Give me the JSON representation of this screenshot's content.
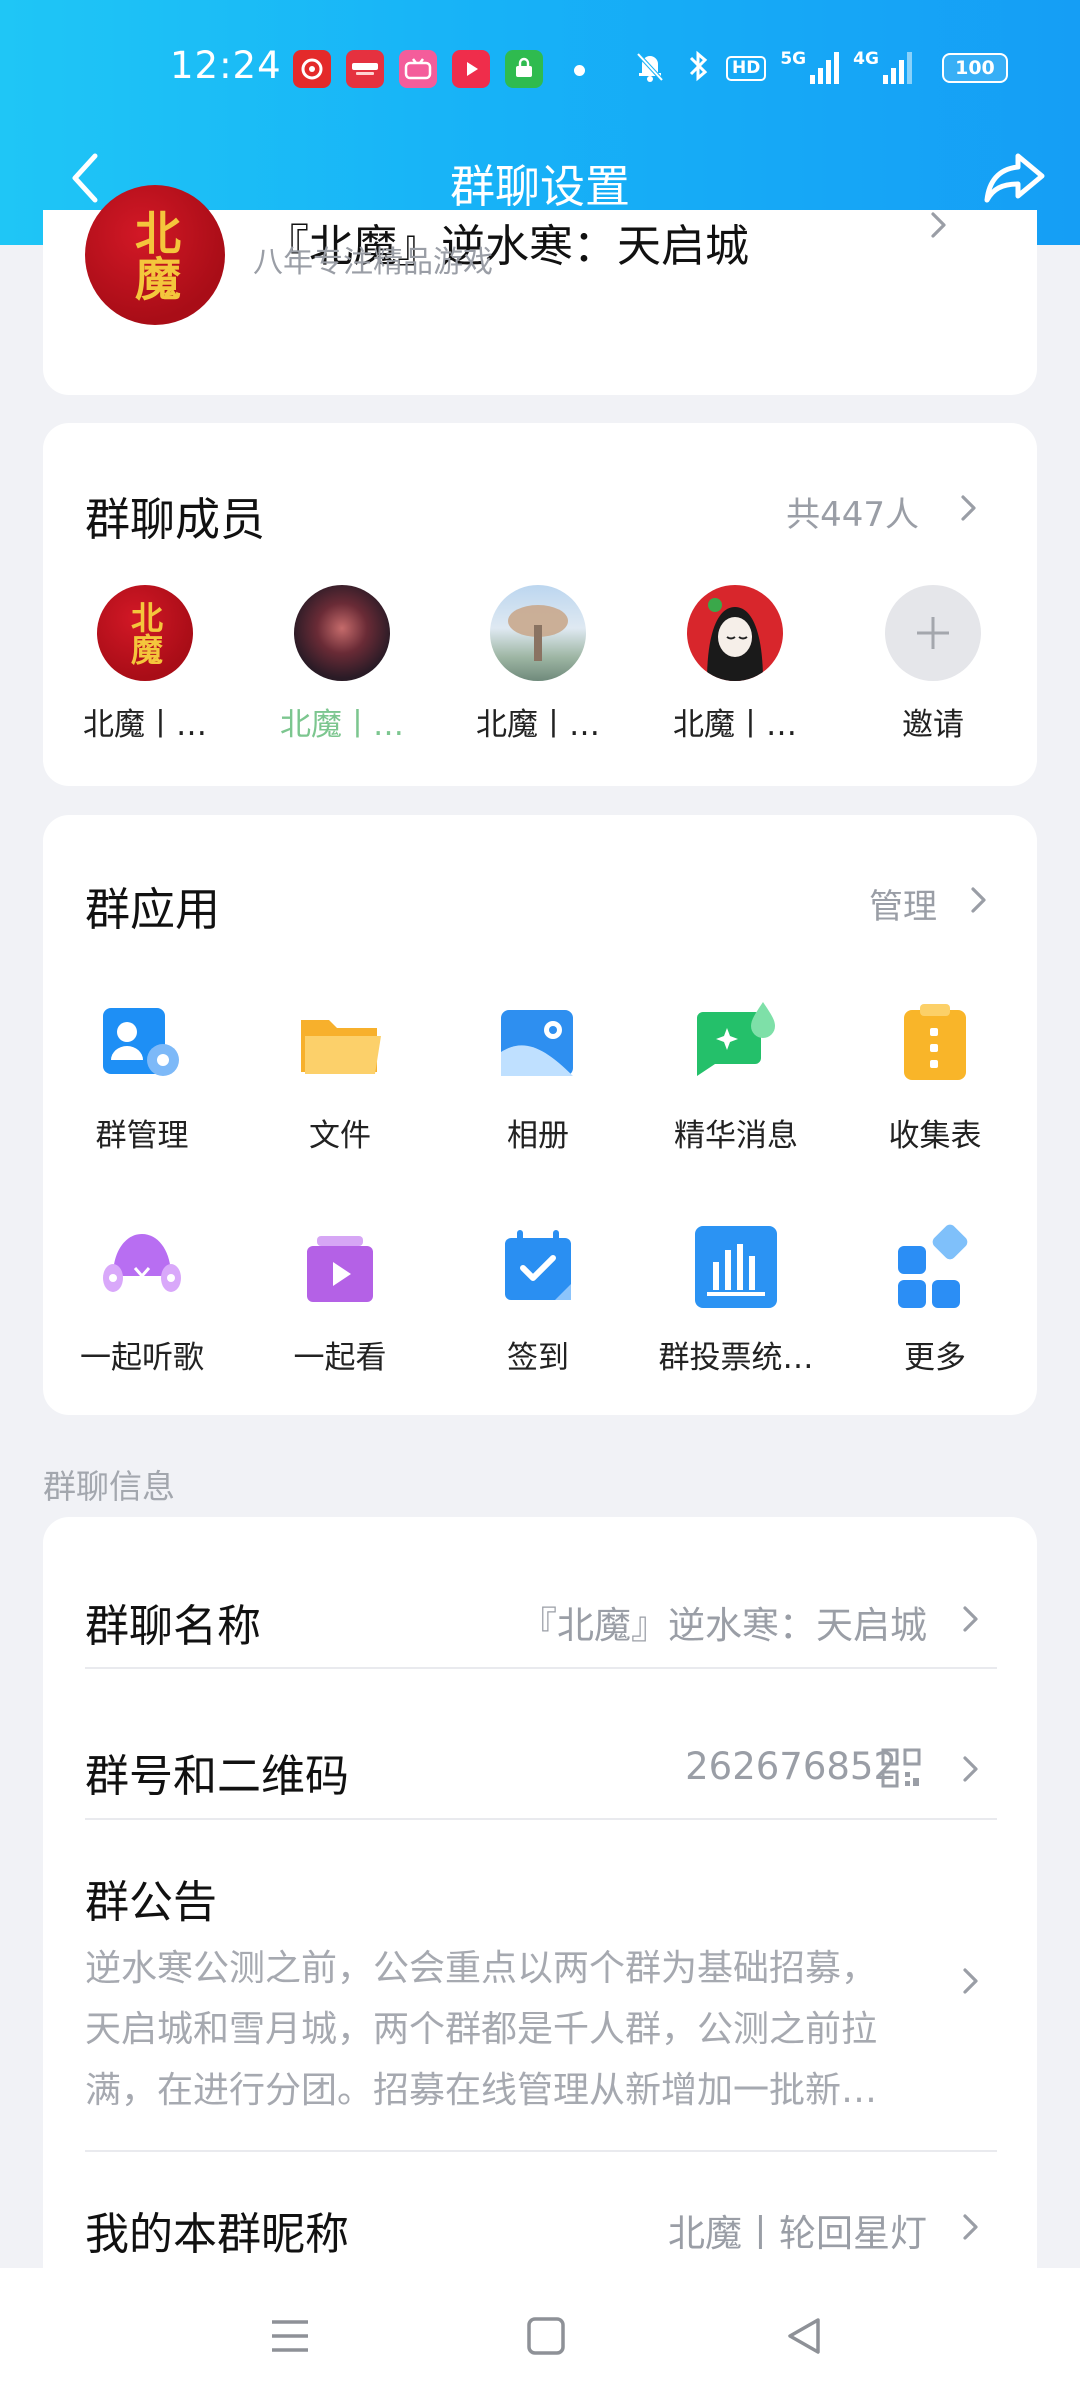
{
  "status_bar": {
    "time": "12:24",
    "network_5g": "5G",
    "network_4g": "4G",
    "hd_label": "HD",
    "battery": "100"
  },
  "nav": {
    "title": "群聊设置",
    "back_icon": "chevron-left-icon",
    "share_icon": "share-arrow-icon"
  },
  "group": {
    "name": "『北魔』逆水寒：天启城",
    "subtitle": "八年专注精品游戏",
    "avatar_text": "北魔"
  },
  "members": {
    "title": "群聊成员",
    "count": "共447人",
    "items": [
      {
        "name": "北魔丨…",
        "color": "#222222"
      },
      {
        "name": "北魔丨…",
        "color": "#7cc68f"
      },
      {
        "name": "北魔丨…",
        "color": "#222222"
      },
      {
        "name": "北魔丨…",
        "color": "#222222"
      }
    ],
    "invite_label": "邀请"
  },
  "apps": {
    "title": "群应用",
    "manage_label": "管理",
    "items": [
      {
        "label": "群管理",
        "icon": "group-admin-icon",
        "color": "#1e8ff5"
      },
      {
        "label": "文件",
        "icon": "folder-icon",
        "color": "#f7b02c"
      },
      {
        "label": "相册",
        "icon": "album-icon",
        "color": "#2e8ff0"
      },
      {
        "label": "精华消息",
        "icon": "highlight-message-icon",
        "color": "#24c06a"
      },
      {
        "label": "收集表",
        "icon": "clipboard-icon",
        "color": "#f9b529"
      },
      {
        "label": "一起听歌",
        "icon": "listen-together-icon",
        "color": "#b86ef2"
      },
      {
        "label": "一起看",
        "icon": "watch-together-icon",
        "color": "#b461e6"
      },
      {
        "label": "签到",
        "icon": "check-in-icon",
        "color": "#2a8ff2"
      },
      {
        "label": "群投票统…",
        "icon": "vote-chart-icon",
        "color": "#2b93f3"
      },
      {
        "label": "更多",
        "icon": "more-apps-icon",
        "color": "#2b8ef5"
      }
    ]
  },
  "info": {
    "section_label": "群聊信息",
    "name_label": "群聊名称",
    "name_value": "『北魔』逆水寒：天启城",
    "number_label": "群号和二维码",
    "number_value": "262676852",
    "notice_label": "群公告",
    "notice_lines": [
      "逆水寒公测之前，公会重点以两个群为基础招募，",
      "天启城和雪月城，两个群都是千人群，公测之前拉",
      "满，在进行分团。招募在线管理从新增加一批新…"
    ],
    "nickname_label": "我的本群昵称",
    "nickname_value": "北魔丨轮回星灯"
  },
  "bottom_nav": {
    "menu_icon": "menu-icon",
    "home_icon": "home-square-icon",
    "back_icon": "back-triangle-icon"
  }
}
